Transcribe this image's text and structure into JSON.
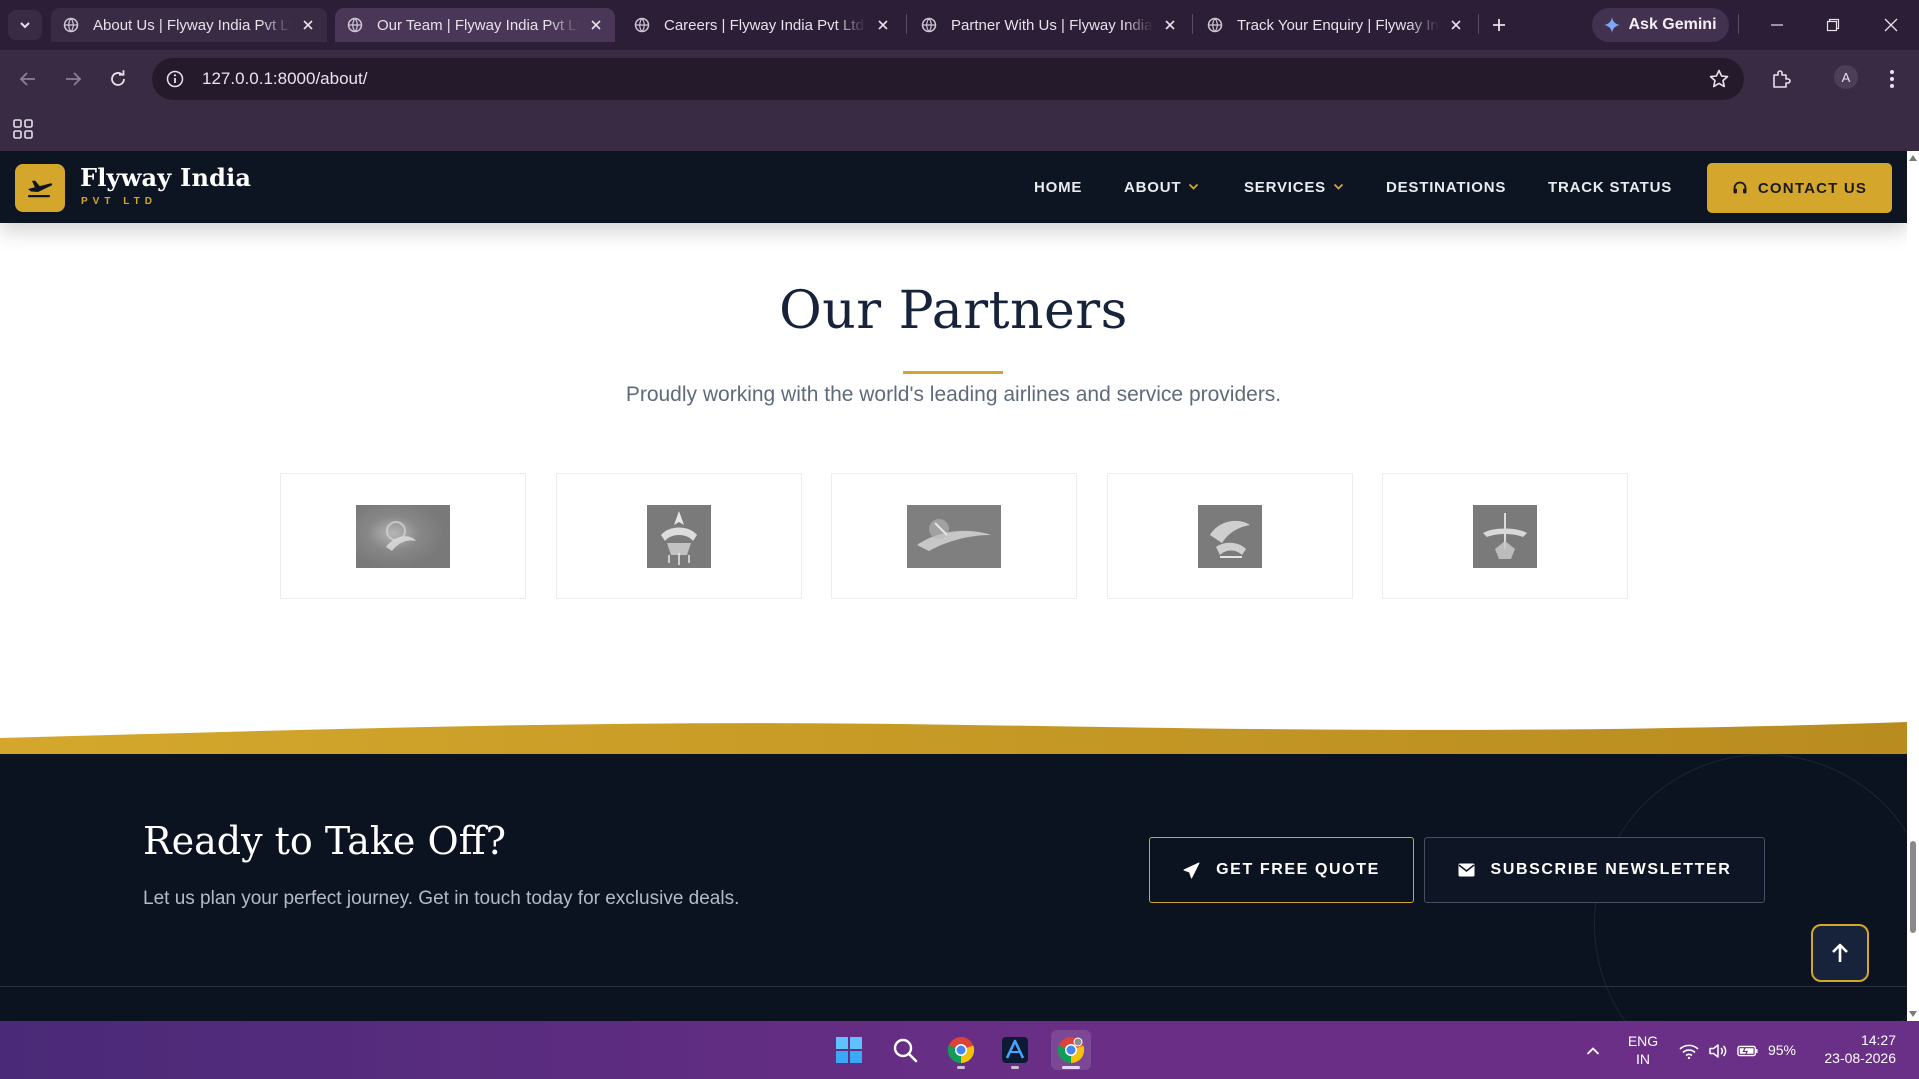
{
  "browser": {
    "tabs": [
      {
        "title": "About Us | Flyway India Pvt Ltd",
        "state": "active"
      },
      {
        "title": "Our Team | Flyway India Pvt Ltd",
        "state": "hovered"
      },
      {
        "title": "Careers | Flyway India Pvt Ltd",
        "state": "normal"
      },
      {
        "title": "Partner With Us | Flyway India",
        "state": "normal"
      },
      {
        "title": "Track Your Enquiry | Flyway India",
        "state": "normal"
      }
    ],
    "gemini_label": "Ask Gemini",
    "url": "127.0.0.1:8000/about/",
    "profile_initial": "A"
  },
  "site": {
    "brand_name": "Flyway India",
    "brand_sub": "PVT LTD",
    "nav": {
      "home": "HOME",
      "about": "ABOUT",
      "services": "SERVICES",
      "destinations": "DESTINATIONS",
      "track": "TRACK STATUS"
    },
    "contact_label": "CONTACT US",
    "colors": {
      "accent": "#d4a72c",
      "navy": "#0d1422",
      "heading": "#16233b"
    }
  },
  "partners": {
    "title": "Our Partners",
    "subtitle": "Proudly working with the world's leading airlines and service providers.",
    "logos": [
      "partner-logo-1",
      "partner-logo-2",
      "partner-logo-3",
      "partner-logo-4",
      "partner-logo-5"
    ]
  },
  "cta": {
    "title": "Ready to Take Off?",
    "subtitle": "Let us plan your perfect journey. Get in touch today for exclusive deals.",
    "quote_label": "GET FREE QUOTE",
    "newsletter_label": "SUBSCRIBE NEWSLETTER"
  },
  "taskbar": {
    "apps": [
      "windows-start-icon",
      "search-icon",
      "chrome-icon",
      "editor-icon",
      "chrome-canary-icon"
    ],
    "lang_primary": "ENG",
    "lang_secondary": "IN",
    "battery": "95%",
    "time": "14:27",
    "date": "23-08-2026"
  }
}
